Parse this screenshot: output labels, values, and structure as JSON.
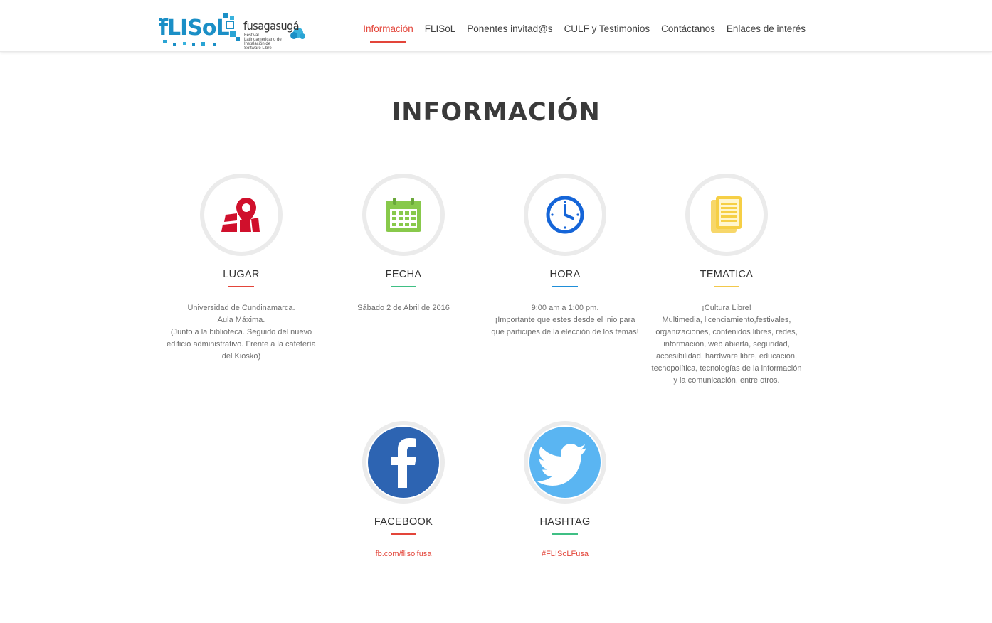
{
  "header": {
    "logo": {
      "main": "fLISoL",
      "city": "fusagasugá",
      "tagline": "Festival Latinoamericano de Instalación de Software Libre"
    },
    "nav": [
      {
        "label": "Información",
        "active": true
      },
      {
        "label": "FLISoL",
        "active": false
      },
      {
        "label": "Ponentes invitad@s",
        "active": false
      },
      {
        "label": "CULF y Testimonios",
        "active": false
      },
      {
        "label": "Contáctanos",
        "active": false
      },
      {
        "label": "Enlaces de interés",
        "active": false
      }
    ]
  },
  "main": {
    "title": "INFORMACIÓN",
    "cards": [
      {
        "title": "LUGAR",
        "icon": "map-pin-icon",
        "accent": "#e3453a",
        "lines": [
          "Universidad de Cundinamarca.",
          "Aula Máxima.",
          "(Junto a la biblioteca. Seguido del nuevo edificio administrativo. Frente a la cafetería del Kiosko)"
        ]
      },
      {
        "title": "FECHA",
        "icon": "calendar-icon",
        "accent": "#3fbf84",
        "lines": [
          "Sábado 2 de Abril de 2016"
        ]
      },
      {
        "title": "HORA",
        "icon": "clock-icon",
        "accent": "#1f8ed8",
        "lines": [
          "9:00 am a 1:00 pm.",
          "¡Importante que estes desde el inio para que participes de la elección de los temas!"
        ]
      },
      {
        "title": "TEMATICA",
        "icon": "document-icon",
        "accent": "#f2c84b",
        "lines": [
          "¡Cultura Libre!",
          "Multimedia, licenciamiento,festivales, organizaciones, contenidos libres, redes, información, web abierta, seguridad, accesibilidad, hardware libre, educación, tecnopolítica, tecnologías de la información y la comunicación, entre otros."
        ]
      }
    ],
    "social": [
      {
        "title": "FACEBOOK",
        "icon": "facebook-icon",
        "accent": "#e3453a",
        "link": "fb.com/flisolfusa"
      },
      {
        "title": "HASHTAG",
        "icon": "twitter-icon",
        "accent": "#3fbf84",
        "link": "#FLISoLFusa"
      }
    ]
  }
}
